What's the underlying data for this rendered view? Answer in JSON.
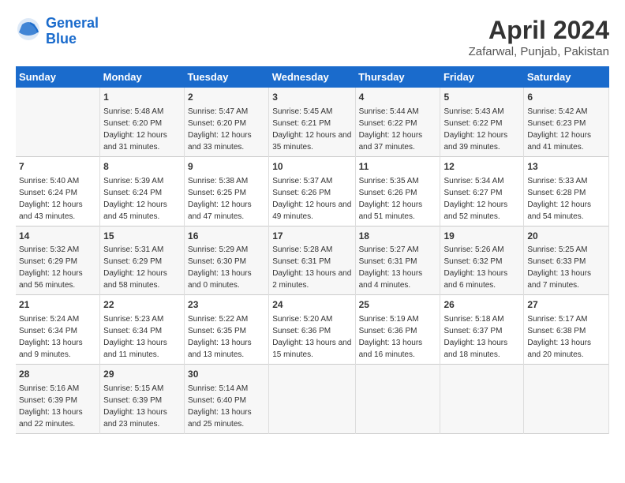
{
  "header": {
    "logo_line1": "General",
    "logo_line2": "Blue",
    "month": "April 2024",
    "location": "Zafarwal, Punjab, Pakistan"
  },
  "days_of_week": [
    "Sunday",
    "Monday",
    "Tuesday",
    "Wednesday",
    "Thursday",
    "Friday",
    "Saturday"
  ],
  "weeks": [
    [
      {
        "day": "",
        "sunrise": "",
        "sunset": "",
        "daylight": ""
      },
      {
        "day": "1",
        "sunrise": "Sunrise: 5:48 AM",
        "sunset": "Sunset: 6:20 PM",
        "daylight": "Daylight: 12 hours and 31 minutes."
      },
      {
        "day": "2",
        "sunrise": "Sunrise: 5:47 AM",
        "sunset": "Sunset: 6:20 PM",
        "daylight": "Daylight: 12 hours and 33 minutes."
      },
      {
        "day": "3",
        "sunrise": "Sunrise: 5:45 AM",
        "sunset": "Sunset: 6:21 PM",
        "daylight": "Daylight: 12 hours and 35 minutes."
      },
      {
        "day": "4",
        "sunrise": "Sunrise: 5:44 AM",
        "sunset": "Sunset: 6:22 PM",
        "daylight": "Daylight: 12 hours and 37 minutes."
      },
      {
        "day": "5",
        "sunrise": "Sunrise: 5:43 AM",
        "sunset": "Sunset: 6:22 PM",
        "daylight": "Daylight: 12 hours and 39 minutes."
      },
      {
        "day": "6",
        "sunrise": "Sunrise: 5:42 AM",
        "sunset": "Sunset: 6:23 PM",
        "daylight": "Daylight: 12 hours and 41 minutes."
      }
    ],
    [
      {
        "day": "7",
        "sunrise": "Sunrise: 5:40 AM",
        "sunset": "Sunset: 6:24 PM",
        "daylight": "Daylight: 12 hours and 43 minutes."
      },
      {
        "day": "8",
        "sunrise": "Sunrise: 5:39 AM",
        "sunset": "Sunset: 6:24 PM",
        "daylight": "Daylight: 12 hours and 45 minutes."
      },
      {
        "day": "9",
        "sunrise": "Sunrise: 5:38 AM",
        "sunset": "Sunset: 6:25 PM",
        "daylight": "Daylight: 12 hours and 47 minutes."
      },
      {
        "day": "10",
        "sunrise": "Sunrise: 5:37 AM",
        "sunset": "Sunset: 6:26 PM",
        "daylight": "Daylight: 12 hours and 49 minutes."
      },
      {
        "day": "11",
        "sunrise": "Sunrise: 5:35 AM",
        "sunset": "Sunset: 6:26 PM",
        "daylight": "Daylight: 12 hours and 51 minutes."
      },
      {
        "day": "12",
        "sunrise": "Sunrise: 5:34 AM",
        "sunset": "Sunset: 6:27 PM",
        "daylight": "Daylight: 12 hours and 52 minutes."
      },
      {
        "day": "13",
        "sunrise": "Sunrise: 5:33 AM",
        "sunset": "Sunset: 6:28 PM",
        "daylight": "Daylight: 12 hours and 54 minutes."
      }
    ],
    [
      {
        "day": "14",
        "sunrise": "Sunrise: 5:32 AM",
        "sunset": "Sunset: 6:29 PM",
        "daylight": "Daylight: 12 hours and 56 minutes."
      },
      {
        "day": "15",
        "sunrise": "Sunrise: 5:31 AM",
        "sunset": "Sunset: 6:29 PM",
        "daylight": "Daylight: 12 hours and 58 minutes."
      },
      {
        "day": "16",
        "sunrise": "Sunrise: 5:29 AM",
        "sunset": "Sunset: 6:30 PM",
        "daylight": "Daylight: 13 hours and 0 minutes."
      },
      {
        "day": "17",
        "sunrise": "Sunrise: 5:28 AM",
        "sunset": "Sunset: 6:31 PM",
        "daylight": "Daylight: 13 hours and 2 minutes."
      },
      {
        "day": "18",
        "sunrise": "Sunrise: 5:27 AM",
        "sunset": "Sunset: 6:31 PM",
        "daylight": "Daylight: 13 hours and 4 minutes."
      },
      {
        "day": "19",
        "sunrise": "Sunrise: 5:26 AM",
        "sunset": "Sunset: 6:32 PM",
        "daylight": "Daylight: 13 hours and 6 minutes."
      },
      {
        "day": "20",
        "sunrise": "Sunrise: 5:25 AM",
        "sunset": "Sunset: 6:33 PM",
        "daylight": "Daylight: 13 hours and 7 minutes."
      }
    ],
    [
      {
        "day": "21",
        "sunrise": "Sunrise: 5:24 AM",
        "sunset": "Sunset: 6:34 PM",
        "daylight": "Daylight: 13 hours and 9 minutes."
      },
      {
        "day": "22",
        "sunrise": "Sunrise: 5:23 AM",
        "sunset": "Sunset: 6:34 PM",
        "daylight": "Daylight: 13 hours and 11 minutes."
      },
      {
        "day": "23",
        "sunrise": "Sunrise: 5:22 AM",
        "sunset": "Sunset: 6:35 PM",
        "daylight": "Daylight: 13 hours and 13 minutes."
      },
      {
        "day": "24",
        "sunrise": "Sunrise: 5:20 AM",
        "sunset": "Sunset: 6:36 PM",
        "daylight": "Daylight: 13 hours and 15 minutes."
      },
      {
        "day": "25",
        "sunrise": "Sunrise: 5:19 AM",
        "sunset": "Sunset: 6:36 PM",
        "daylight": "Daylight: 13 hours and 16 minutes."
      },
      {
        "day": "26",
        "sunrise": "Sunrise: 5:18 AM",
        "sunset": "Sunset: 6:37 PM",
        "daylight": "Daylight: 13 hours and 18 minutes."
      },
      {
        "day": "27",
        "sunrise": "Sunrise: 5:17 AM",
        "sunset": "Sunset: 6:38 PM",
        "daylight": "Daylight: 13 hours and 20 minutes."
      }
    ],
    [
      {
        "day": "28",
        "sunrise": "Sunrise: 5:16 AM",
        "sunset": "Sunset: 6:39 PM",
        "daylight": "Daylight: 13 hours and 22 minutes."
      },
      {
        "day": "29",
        "sunrise": "Sunrise: 5:15 AM",
        "sunset": "Sunset: 6:39 PM",
        "daylight": "Daylight: 13 hours and 23 minutes."
      },
      {
        "day": "30",
        "sunrise": "Sunrise: 5:14 AM",
        "sunset": "Sunset: 6:40 PM",
        "daylight": "Daylight: 13 hours and 25 minutes."
      },
      {
        "day": "",
        "sunrise": "",
        "sunset": "",
        "daylight": ""
      },
      {
        "day": "",
        "sunrise": "",
        "sunset": "",
        "daylight": ""
      },
      {
        "day": "",
        "sunrise": "",
        "sunset": "",
        "daylight": ""
      },
      {
        "day": "",
        "sunrise": "",
        "sunset": "",
        "daylight": ""
      }
    ]
  ]
}
